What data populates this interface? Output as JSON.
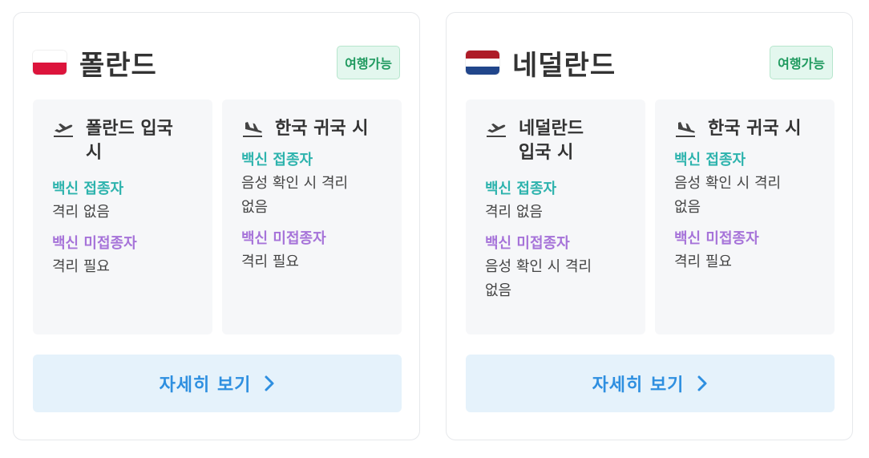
{
  "cards": [
    {
      "country": "폴란드",
      "flag_icon": "poland-flag-icon",
      "flag_colors": [
        "#ffffff",
        "#dc143c"
      ],
      "badge": "여행가능",
      "entry": {
        "title_line1": "폴란드 입국",
        "title_line2": "시",
        "icon": "plane-departure-icon",
        "vaccinated_label": "백신 접종자",
        "vaccinated_value": "격리 없음",
        "unvaccinated_label": "백신 미접종자",
        "unvaccinated_value_line1": "격리 필요",
        "unvaccinated_value_line2": ""
      },
      "return": {
        "title": "한국 귀국 시",
        "icon": "plane-arrival-icon",
        "vaccinated_label": "백신 접종자",
        "vaccinated_value_line1": "음성 확인 시 격리",
        "vaccinated_value_line2": "없음",
        "unvaccinated_label": "백신 미접종자",
        "unvaccinated_value": "격리 필요"
      },
      "button_label": "자세히 보기"
    },
    {
      "country": "네덜란드",
      "flag_icon": "netherlands-flag-icon",
      "flag_colors": [
        "#ae1c28",
        "#ffffff",
        "#21468b"
      ],
      "badge": "여행가능",
      "entry": {
        "title_line1": "네덜란드",
        "title_line2": "입국 시",
        "icon": "plane-departure-icon",
        "vaccinated_label": "백신 접종자",
        "vaccinated_value": "격리 없음",
        "unvaccinated_label": "백신 미접종자",
        "unvaccinated_value_line1": "음성 확인 시 격리",
        "unvaccinated_value_line2": "없음"
      },
      "return": {
        "title": "한국 귀국 시",
        "icon": "plane-arrival-icon",
        "vaccinated_label": "백신 접종자",
        "vaccinated_value_line1": "음성 확인 시 격리",
        "vaccinated_value_line2": "없음",
        "unvaccinated_label": "백신 미접종자",
        "unvaccinated_value": "격리 필요"
      },
      "button_label": "자세히 보기"
    }
  ],
  "colors": {
    "badge_text": "#1f9a5f",
    "badge_bg": "#e3f7ee",
    "vaccinated": "#2db3ad",
    "unvaccinated": "#a673d9",
    "button_text": "#2e8fe0",
    "button_bg": "#e5f2fb",
    "panel_bg": "#f6f7f9"
  }
}
